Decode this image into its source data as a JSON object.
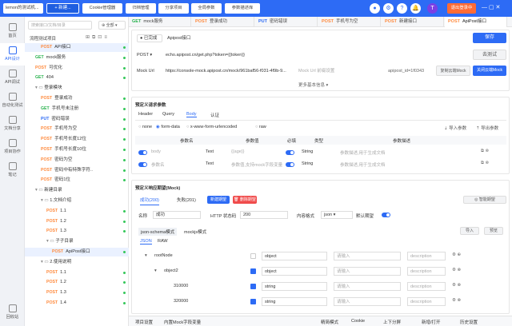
{
  "topbar": {
    "brand": "lemon的测试机...",
    "new": "+ 新建...",
    "tools": [
      "Cookie管理器",
      "归档管理",
      "分享项目",
      "全局参数",
      "参数描述库"
    ],
    "exit": "退出登录中",
    "avatar": "T"
  },
  "rail": [
    "首页",
    "API设计",
    "API调试",
    "自动化测试",
    "文档分享",
    "项目协作",
    "笔记",
    "回收站"
  ],
  "tree": {
    "search": "搜索接口/文档/目录",
    "filter": "全部",
    "title": "流程测试项目",
    "rows": [
      {
        "m": "POST",
        "t": "API接口",
        "indent": 2,
        "active": true
      },
      {
        "m": "GET",
        "t": "mock服务",
        "indent": 1
      },
      {
        "m": "POST",
        "t": "可优化",
        "indent": 1
      },
      {
        "m": "GET",
        "t": "404",
        "indent": 1
      },
      {
        "m": "",
        "t": "登录模块",
        "indent": 1,
        "folder": true
      },
      {
        "m": "POST",
        "t": "登录成功",
        "indent": 2
      },
      {
        "m": "GET",
        "t": "手机号未注册",
        "indent": 2
      },
      {
        "m": "PUT",
        "t": "密码错误",
        "indent": 2
      },
      {
        "m": "POST",
        "t": "手机号为空",
        "indent": 2
      },
      {
        "m": "POST",
        "t": "手机号长度12位",
        "indent": 2
      },
      {
        "m": "POST",
        "t": "手机号长度10位",
        "indent": 2
      },
      {
        "m": "POST",
        "t": "密码为空",
        "indent": 2
      },
      {
        "m": "POST",
        "t": "密码中有特殊字符..",
        "indent": 2
      },
      {
        "m": "POST",
        "t": "密码1位",
        "indent": 2
      },
      {
        "m": "",
        "t": "新建目录",
        "indent": 1,
        "folder": true
      },
      {
        "m": "",
        "t": "1.文档介绍",
        "indent": 2,
        "folder": true
      },
      {
        "m": "POST",
        "t": "1.1",
        "indent": 3
      },
      {
        "m": "POST",
        "t": "1.2",
        "indent": 3
      },
      {
        "m": "POST",
        "t": "1.3",
        "indent": 3
      },
      {
        "m": "",
        "t": "子子目录",
        "indent": 3,
        "folder": true
      },
      {
        "m": "POST",
        "t": "ApiPost接口",
        "indent": 4,
        "active": true
      },
      {
        "m": "",
        "t": "2.使用说明",
        "indent": 2,
        "folder": true
      },
      {
        "m": "POST",
        "t": "1.1",
        "indent": 3
      },
      {
        "m": "POST",
        "t": "1.2",
        "indent": 3
      },
      {
        "m": "POST",
        "t": "1.3",
        "indent": 3
      },
      {
        "m": "POST",
        "t": "1.4",
        "indent": 3
      }
    ]
  },
  "tabs": [
    {
      "m": "GET",
      "t": "mock服务"
    },
    {
      "m": "POST",
      "t": "登录成功"
    },
    {
      "m": "PUT",
      "t": "密码错误"
    },
    {
      "m": "POST",
      "t": "手机号为空"
    },
    {
      "m": "POST",
      "t": "新建接口"
    },
    {
      "m": "POST",
      "t": "ApiPost接口",
      "active": true
    }
  ],
  "req": {
    "status": "已完成",
    "name": "Apipost接口",
    "save": "保存",
    "method": "POST",
    "url": "echo.apipost.cn/get.php?token={{token}}",
    "urlbtn": "去测试",
    "mock_label": "Mock Url",
    "mock_url": "https://console-mock.apipost.cn/mock/961baf56-f031-4f9b-9...",
    "mock_ph": "Mock Url 前缀设置",
    "api_id": "apipost_id=1f0343",
    "copy_mock": "复制云端Mock",
    "close_mock": "关闭云端Mock",
    "more": "更多基本信息 ▾"
  },
  "params": {
    "title": "预定义请求参数",
    "tabs": [
      "Header",
      "Query",
      "Body",
      "认证"
    ],
    "active_tab": "Body",
    "modes": [
      "none",
      "form-data",
      "x-www-form-urlencoded",
      "raw"
    ],
    "import": "导入参数",
    "export": "导出参数",
    "cols": [
      "参数名",
      "参数值",
      "必填",
      "类型",
      "参数描述"
    ],
    "rows": [
      {
        "name": "body",
        "type": "Text",
        "value": "{{age}}",
        "vtype": "String",
        "desc": "参数描述,用于生成文档"
      },
      {
        "name": "参数名",
        "type": "Text",
        "value": "参数值,支持mock字段变量",
        "vtype": "String",
        "desc": "参数描述,用于生成文档"
      }
    ]
  },
  "resp": {
    "title": "预定义响应期望(Mock)",
    "tabs": [
      "成功(200)",
      "失败(201)"
    ],
    "new": "新建期望",
    "del": "删除期望",
    "smart": "智能期望",
    "name_label": "名称",
    "name_val": "成功",
    "code_label": "HTTP 状态码",
    "code_val": "200",
    "ctype_label": "内容格式",
    "ctype_val": "json",
    "default_label": "默认期望",
    "modes": [
      "json-schema模式",
      "mockjs模式"
    ],
    "import": "导入",
    "preview": "预览",
    "fmt": [
      "JSON",
      "RAW"
    ],
    "schema": [
      {
        "key": "rootNode",
        "type": "object",
        "ph": "请输入",
        "desc": "description",
        "lvl": 0
      },
      {
        "key": "object2",
        "type": "object",
        "ph": "请输入",
        "desc": "description",
        "lvl": 1
      },
      {
        "key": "310000",
        "type": "string",
        "ph": "请输入",
        "desc": "description",
        "lvl": 2
      },
      {
        "key": "320000",
        "type": "string",
        "ph": "请输入",
        "desc": "description",
        "lvl": 2
      }
    ]
  },
  "bottom": {
    "left": [
      "项目设置",
      "内置Mock字段变量"
    ],
    "right": [
      "精简模式",
      "Cookie",
      "上下分屏",
      "新增/打开",
      "历史设置"
    ]
  }
}
